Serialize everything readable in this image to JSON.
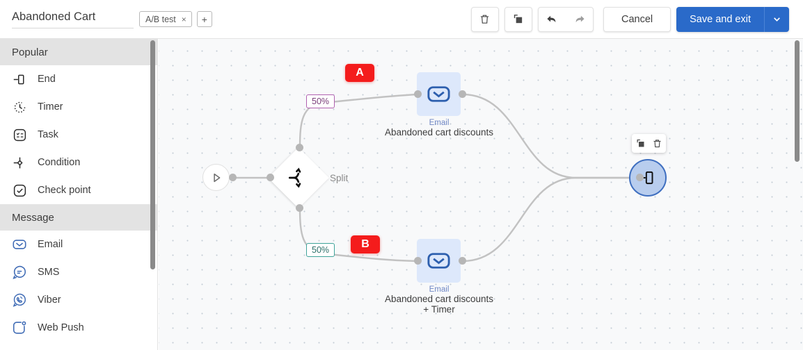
{
  "header": {
    "flow_title": "Abandoned Cart",
    "tabs": [
      {
        "label": "A/B test",
        "close": "×"
      }
    ],
    "add_tab_label": "+",
    "delete_icon": "trash-icon",
    "copy_icon": "copy-icon",
    "undo_icon": "undo-arrow-icon",
    "redo_icon": "redo-arrow-icon",
    "cancel_label": "Cancel",
    "save_label": "Save and exit",
    "save_caret": "chevron-down-icon",
    "accent_color": "#2a6ac9"
  },
  "sidebar": {
    "sections": [
      {
        "title": "Popular",
        "items": [
          {
            "label": "End",
            "icon": "end-icon"
          },
          {
            "label": "Timer",
            "icon": "timer-icon"
          },
          {
            "label": "Task",
            "icon": "task-icon"
          },
          {
            "label": "Condition",
            "icon": "condition-icon"
          },
          {
            "label": "Check point",
            "icon": "check-point-icon"
          }
        ]
      },
      {
        "title": "Message",
        "items": [
          {
            "label": "Email",
            "icon": "email-icon"
          },
          {
            "label": "SMS",
            "icon": "sms-icon"
          },
          {
            "label": "Viber",
            "icon": "viber-icon"
          },
          {
            "label": "Web Push",
            "icon": "web-push-icon"
          }
        ]
      }
    ]
  },
  "canvas": {
    "start_node": {
      "icon": "play-icon"
    },
    "split_node": {
      "label": "Split",
      "icon": "split-icon"
    },
    "branch_a": {
      "percent": "50%",
      "badge": "A",
      "node_type": "Email",
      "node_name": "Abandoned cart discounts",
      "icon": "envelope-icon"
    },
    "branch_b": {
      "percent": "50%",
      "badge": "B",
      "node_type": "Email",
      "node_name": "Abandoned cart discounts",
      "node_name2": "+ Timer",
      "icon": "envelope-icon"
    },
    "end_node": {
      "icon": "end-icon"
    },
    "hover_tools": {
      "copy_icon": "copy-icon",
      "delete_icon": "trash-icon"
    }
  }
}
